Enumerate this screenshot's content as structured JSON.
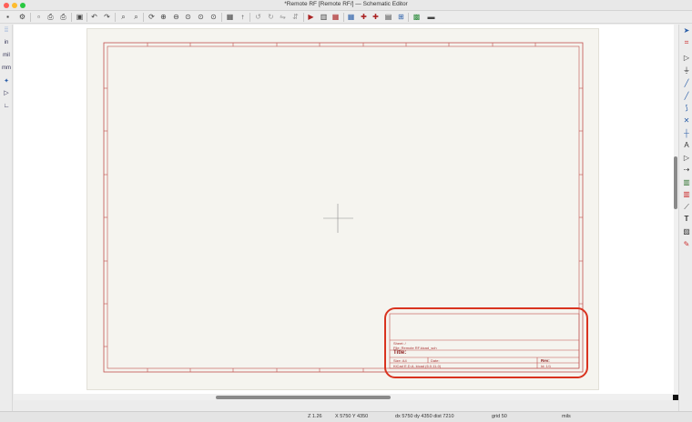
{
  "window": {
    "title": "*Remote RF [Remote RF/] — Schematic Editor"
  },
  "left_toolbar": {
    "units": [
      "in",
      "mil",
      "mm"
    ]
  },
  "title_block": {
    "sheet": "Sheet: /",
    "file": "File: Remote RF.kicad_sch",
    "title": "Title:",
    "size_label": "Size: A4",
    "date_label": "Date:",
    "kicad_version": "KiCad E.D.A.  kicad (6.0.11-0)",
    "rev_label": "Rev:",
    "id_label": "Id: 1/1"
  },
  "highlight": {
    "color": "#d9331f"
  },
  "colors": {
    "sheet_border": "#c0504d",
    "page": "#f5f4ef"
  },
  "statusbar": {
    "zoom": "Z 1.26",
    "coords": "X 5750  Y 4350",
    "delta": "dx 5750  dy 4350  dist 7210",
    "grid": "grid 50",
    "units": "mils"
  }
}
